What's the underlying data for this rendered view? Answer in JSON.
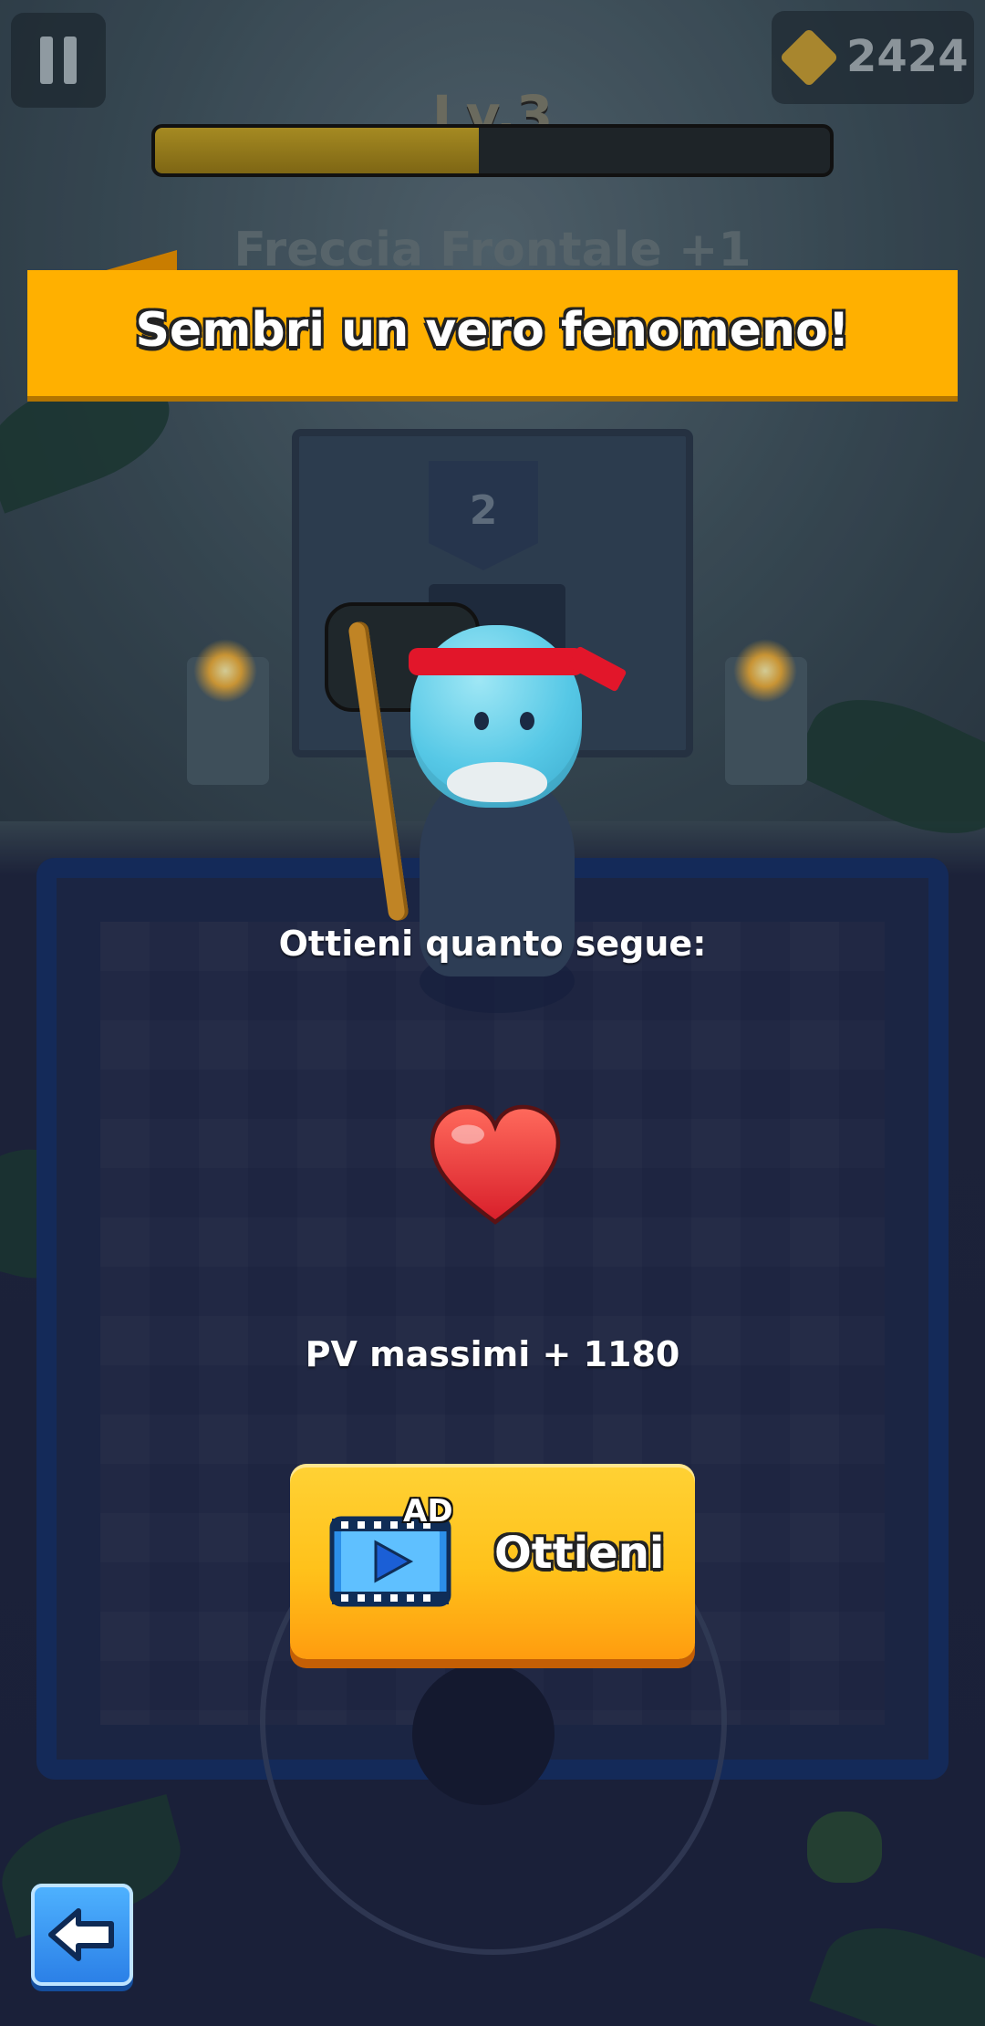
{
  "hud": {
    "level_label": "Lv.3",
    "xp_progress": 0.48,
    "gem_count": "2424",
    "skill_title": "Freccia Frontale +1",
    "pause_icon": "pause-icon",
    "gem_icon": "gem-icon"
  },
  "banner": {
    "text": "Sembri un vero fenomeno!"
  },
  "scene": {
    "room_number": "2"
  },
  "reward": {
    "title": "Ottieni quanto segue:",
    "item_icon": "heart-icon",
    "value_text": "PV massimi + 1180"
  },
  "claim_button": {
    "ad_tag": "AD",
    "label": "Ottieni",
    "icon": "video-ad-icon"
  },
  "back_button": {
    "icon": "back-arrow-icon"
  },
  "colors": {
    "banner": "#ffb000",
    "button": "#ffc11a",
    "back_button": "#2a7ee6"
  }
}
